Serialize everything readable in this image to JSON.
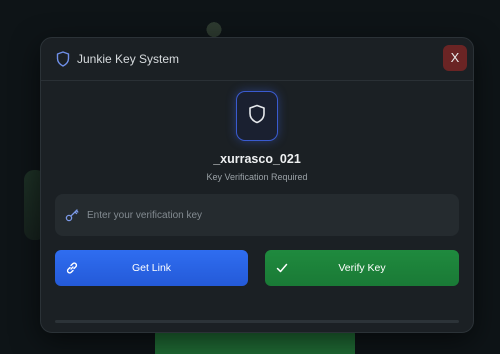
{
  "window": {
    "title": "Junkie Key System",
    "close_label": "X"
  },
  "profile": {
    "username": "_xurrasco_021",
    "status": "Key Verification Required"
  },
  "key_input": {
    "value": "",
    "placeholder": "Enter your verification key"
  },
  "buttons": {
    "get_link_label": "Get Link",
    "verify_label": "Verify Key"
  },
  "icons": {
    "header": "shield-icon",
    "badge": "shield-icon",
    "input": "key-icon",
    "get_link": "link-icon",
    "verify": "check-icon",
    "close": "close-icon"
  },
  "colors": {
    "accent_blue": "#2f6df0",
    "accent_green": "#1f8a3e",
    "close_red": "#6a2424",
    "panel": "#1b2024"
  }
}
